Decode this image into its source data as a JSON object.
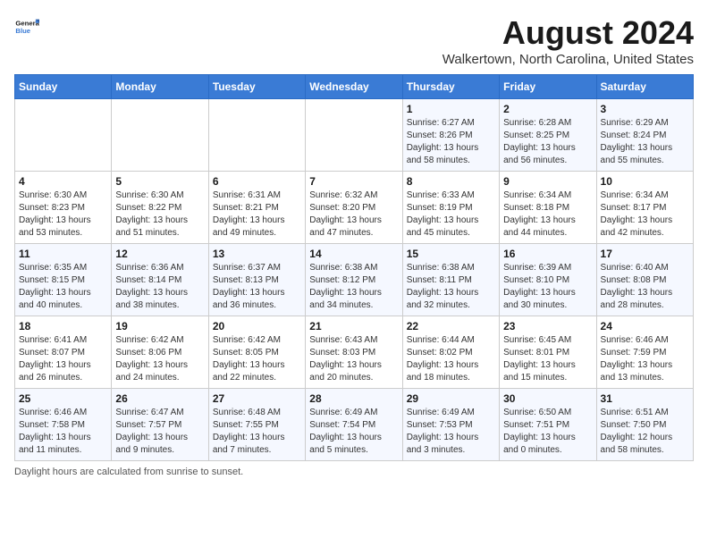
{
  "logo": {
    "line1": "General",
    "line2": "Blue"
  },
  "title": "August 2024",
  "location": "Walkertown, North Carolina, United States",
  "days_of_week": [
    "Sunday",
    "Monday",
    "Tuesday",
    "Wednesday",
    "Thursday",
    "Friday",
    "Saturday"
  ],
  "weeks": [
    [
      {
        "day": "",
        "info": ""
      },
      {
        "day": "",
        "info": ""
      },
      {
        "day": "",
        "info": ""
      },
      {
        "day": "",
        "info": ""
      },
      {
        "day": "1",
        "info": "Sunrise: 6:27 AM\nSunset: 8:26 PM\nDaylight: 13 hours\nand 58 minutes."
      },
      {
        "day": "2",
        "info": "Sunrise: 6:28 AM\nSunset: 8:25 PM\nDaylight: 13 hours\nand 56 minutes."
      },
      {
        "day": "3",
        "info": "Sunrise: 6:29 AM\nSunset: 8:24 PM\nDaylight: 13 hours\nand 55 minutes."
      }
    ],
    [
      {
        "day": "4",
        "info": "Sunrise: 6:30 AM\nSunset: 8:23 PM\nDaylight: 13 hours\nand 53 minutes."
      },
      {
        "day": "5",
        "info": "Sunrise: 6:30 AM\nSunset: 8:22 PM\nDaylight: 13 hours\nand 51 minutes."
      },
      {
        "day": "6",
        "info": "Sunrise: 6:31 AM\nSunset: 8:21 PM\nDaylight: 13 hours\nand 49 minutes."
      },
      {
        "day": "7",
        "info": "Sunrise: 6:32 AM\nSunset: 8:20 PM\nDaylight: 13 hours\nand 47 minutes."
      },
      {
        "day": "8",
        "info": "Sunrise: 6:33 AM\nSunset: 8:19 PM\nDaylight: 13 hours\nand 45 minutes."
      },
      {
        "day": "9",
        "info": "Sunrise: 6:34 AM\nSunset: 8:18 PM\nDaylight: 13 hours\nand 44 minutes."
      },
      {
        "day": "10",
        "info": "Sunrise: 6:34 AM\nSunset: 8:17 PM\nDaylight: 13 hours\nand 42 minutes."
      }
    ],
    [
      {
        "day": "11",
        "info": "Sunrise: 6:35 AM\nSunset: 8:15 PM\nDaylight: 13 hours\nand 40 minutes."
      },
      {
        "day": "12",
        "info": "Sunrise: 6:36 AM\nSunset: 8:14 PM\nDaylight: 13 hours\nand 38 minutes."
      },
      {
        "day": "13",
        "info": "Sunrise: 6:37 AM\nSunset: 8:13 PM\nDaylight: 13 hours\nand 36 minutes."
      },
      {
        "day": "14",
        "info": "Sunrise: 6:38 AM\nSunset: 8:12 PM\nDaylight: 13 hours\nand 34 minutes."
      },
      {
        "day": "15",
        "info": "Sunrise: 6:38 AM\nSunset: 8:11 PM\nDaylight: 13 hours\nand 32 minutes."
      },
      {
        "day": "16",
        "info": "Sunrise: 6:39 AM\nSunset: 8:10 PM\nDaylight: 13 hours\nand 30 minutes."
      },
      {
        "day": "17",
        "info": "Sunrise: 6:40 AM\nSunset: 8:08 PM\nDaylight: 13 hours\nand 28 minutes."
      }
    ],
    [
      {
        "day": "18",
        "info": "Sunrise: 6:41 AM\nSunset: 8:07 PM\nDaylight: 13 hours\nand 26 minutes."
      },
      {
        "day": "19",
        "info": "Sunrise: 6:42 AM\nSunset: 8:06 PM\nDaylight: 13 hours\nand 24 minutes."
      },
      {
        "day": "20",
        "info": "Sunrise: 6:42 AM\nSunset: 8:05 PM\nDaylight: 13 hours\nand 22 minutes."
      },
      {
        "day": "21",
        "info": "Sunrise: 6:43 AM\nSunset: 8:03 PM\nDaylight: 13 hours\nand 20 minutes."
      },
      {
        "day": "22",
        "info": "Sunrise: 6:44 AM\nSunset: 8:02 PM\nDaylight: 13 hours\nand 18 minutes."
      },
      {
        "day": "23",
        "info": "Sunrise: 6:45 AM\nSunset: 8:01 PM\nDaylight: 13 hours\nand 15 minutes."
      },
      {
        "day": "24",
        "info": "Sunrise: 6:46 AM\nSunset: 7:59 PM\nDaylight: 13 hours\nand 13 minutes."
      }
    ],
    [
      {
        "day": "25",
        "info": "Sunrise: 6:46 AM\nSunset: 7:58 PM\nDaylight: 13 hours\nand 11 minutes."
      },
      {
        "day": "26",
        "info": "Sunrise: 6:47 AM\nSunset: 7:57 PM\nDaylight: 13 hours\nand 9 minutes."
      },
      {
        "day": "27",
        "info": "Sunrise: 6:48 AM\nSunset: 7:55 PM\nDaylight: 13 hours\nand 7 minutes."
      },
      {
        "day": "28",
        "info": "Sunrise: 6:49 AM\nSunset: 7:54 PM\nDaylight: 13 hours\nand 5 minutes."
      },
      {
        "day": "29",
        "info": "Sunrise: 6:49 AM\nSunset: 7:53 PM\nDaylight: 13 hours\nand 3 minutes."
      },
      {
        "day": "30",
        "info": "Sunrise: 6:50 AM\nSunset: 7:51 PM\nDaylight: 13 hours\nand 0 minutes."
      },
      {
        "day": "31",
        "info": "Sunrise: 6:51 AM\nSunset: 7:50 PM\nDaylight: 12 hours\nand 58 minutes."
      }
    ]
  ],
  "footer": {
    "note1": "Daylight hours",
    "note2": "are calculated from sunrise to sunset."
  },
  "colors": {
    "header_bg": "#3a7bd5",
    "header_text": "#ffffff",
    "row_odd": "#f5f8ff",
    "row_even": "#ffffff"
  }
}
